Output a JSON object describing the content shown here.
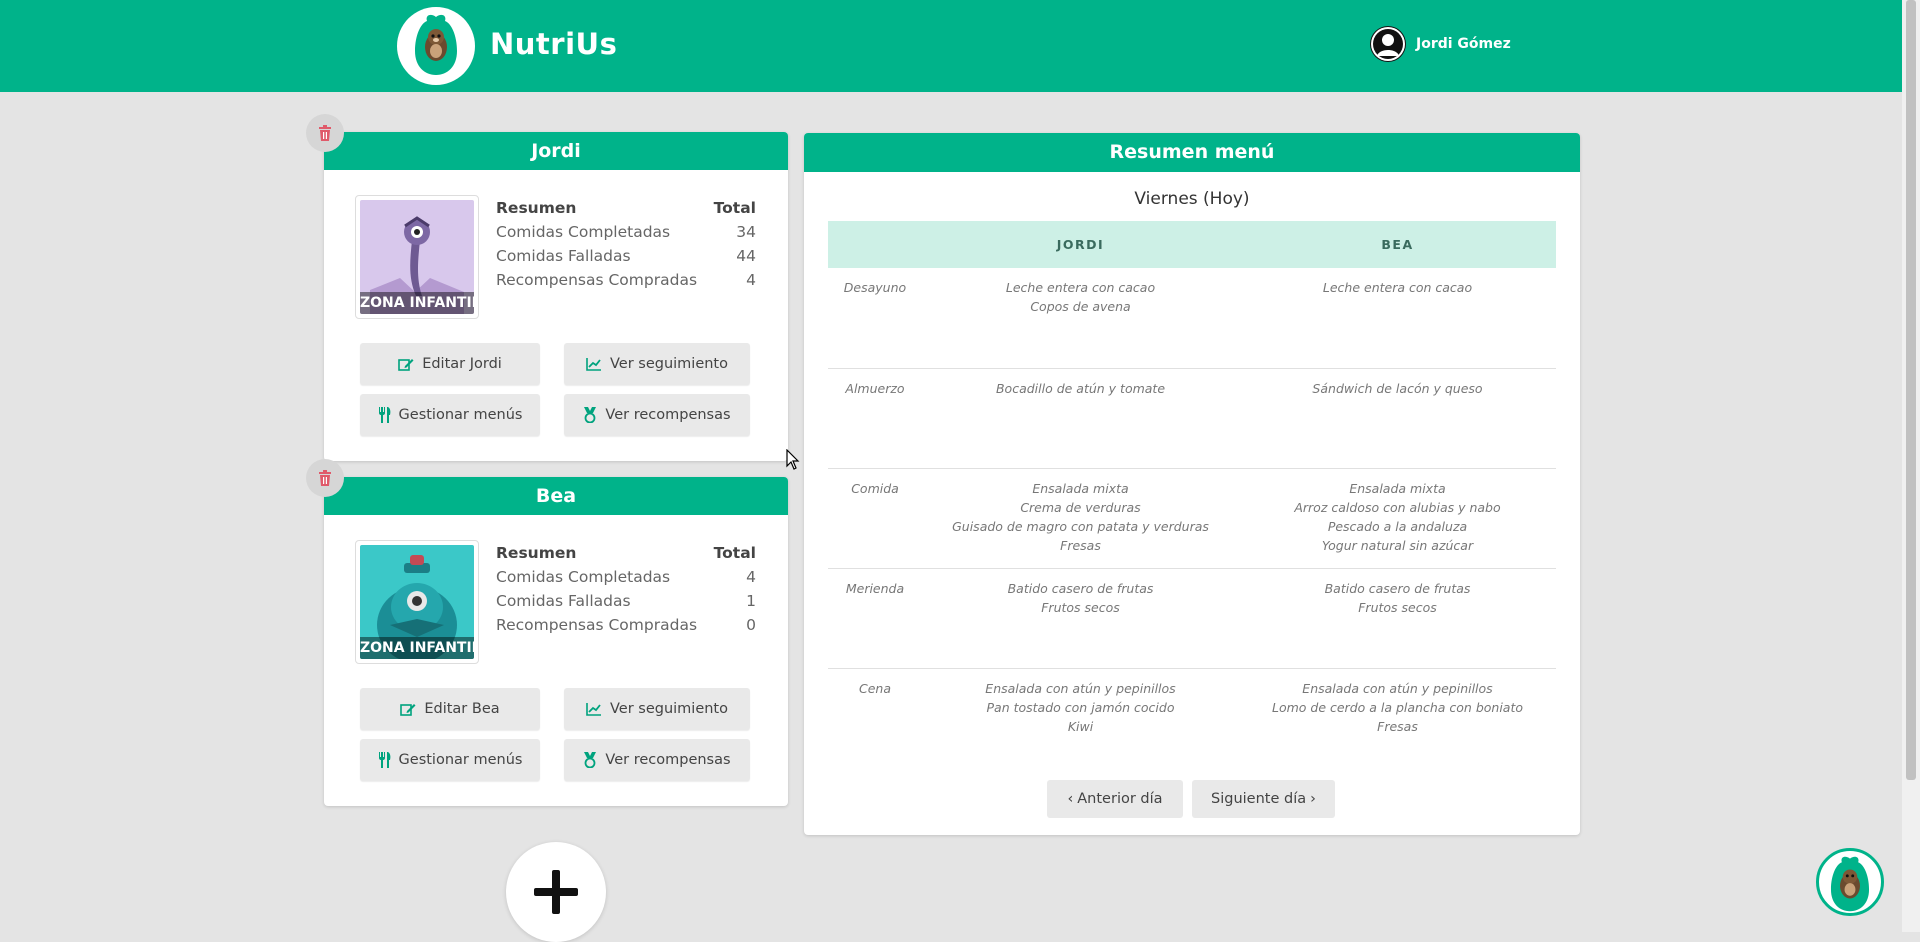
{
  "header": {
    "brand": "NutriUs",
    "user_name": "Jordi Gómez"
  },
  "colors": {
    "primary": "#00b38a",
    "table_header": "#cdf0e6",
    "delete_icon": "#e05a6a"
  },
  "stats_header": {
    "summary": "Resumen",
    "total": "Total"
  },
  "children": [
    {
      "name": "Jordi",
      "badge": "ZONA INFANTIL",
      "avatar_color": "#d8c8ec",
      "stats": [
        {
          "label": "Comidas Completadas",
          "value": "34"
        },
        {
          "label": "Comidas Falladas",
          "value": "44"
        },
        {
          "label": "Recompensas Compradas",
          "value": "4"
        }
      ],
      "buttons": {
        "edit": "Editar Jordi",
        "tracking": "Ver seguimiento",
        "menus": "Gestionar menús",
        "rewards": "Ver recompensas"
      }
    },
    {
      "name": "Bea",
      "badge": "ZONA INFANTIL",
      "avatar_color": "#3bc8c8",
      "stats": [
        {
          "label": "Comidas Completadas",
          "value": "4"
        },
        {
          "label": "Comidas Falladas",
          "value": "1"
        },
        {
          "label": "Recompensas Compradas",
          "value": "0"
        }
      ],
      "buttons": {
        "edit": "Editar Bea",
        "tracking": "Ver seguimiento",
        "menus": "Gestionar menús",
        "rewards": "Ver recompensas"
      }
    }
  ],
  "menu": {
    "title": "Resumen menú",
    "day": "Viernes (Hoy)",
    "columns": [
      "",
      "JORDI",
      "BEA"
    ],
    "rows": [
      {
        "meal": "Desayuno",
        "jordi": [
          "Leche entera con cacao",
          "Copos de avena"
        ],
        "bea": [
          "Leche entera con cacao"
        ]
      },
      {
        "meal": "Almuerzo",
        "jordi": [
          "Bocadillo de atún y tomate"
        ],
        "bea": [
          "Sándwich de lacón y queso"
        ]
      },
      {
        "meal": "Comida",
        "jordi": [
          "Ensalada mixta",
          "Crema de verduras",
          "Guisado de magro con patata y verduras",
          "Fresas"
        ],
        "bea": [
          "Ensalada mixta",
          "Arroz caldoso con alubias y nabo",
          "Pescado a la andaluza",
          "Yogur natural sin azúcar"
        ]
      },
      {
        "meal": "Merienda",
        "jordi": [
          "Batido casero de frutas",
          "Frutos secos"
        ],
        "bea": [
          "Batido casero de frutas",
          "Frutos secos"
        ]
      },
      {
        "meal": "Cena",
        "jordi": [
          "Ensalada con atún y pepinillos",
          "Pan tostado con jamón cocido",
          "Kiwi"
        ],
        "bea": [
          "Ensalada con atún y pepinillos",
          "Lomo de cerdo a la plancha con boniato",
          "Fresas"
        ]
      }
    ],
    "prev_button": "Anterior día",
    "next_button": "Siguiente día"
  }
}
